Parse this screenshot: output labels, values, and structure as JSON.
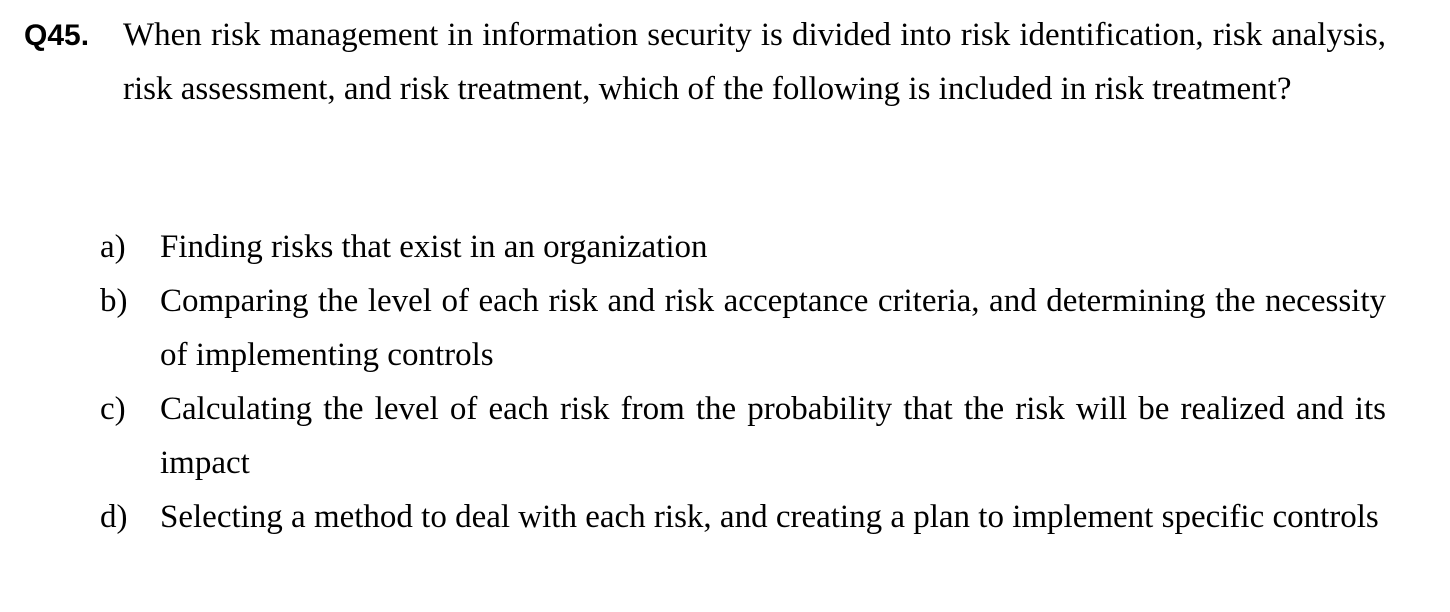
{
  "question": {
    "number": "Q45.",
    "text": "When risk management in information security is divided into risk identification, risk analysis, risk assessment, and risk treatment, which of the following is included in risk treatment?"
  },
  "choices": [
    {
      "letter": "a)",
      "text": "Finding risks that exist in an organization"
    },
    {
      "letter": "b)",
      "text": "Comparing the level of each risk and risk acceptance criteria, and determining the necessity of implementing controls"
    },
    {
      "letter": "c)",
      "text": "Calculating the level of each risk from the probability that the risk will be realized and its impact"
    },
    {
      "letter": "d)",
      "text": "Selecting a method to deal with each risk, and creating a plan to implement specific controls"
    }
  ]
}
